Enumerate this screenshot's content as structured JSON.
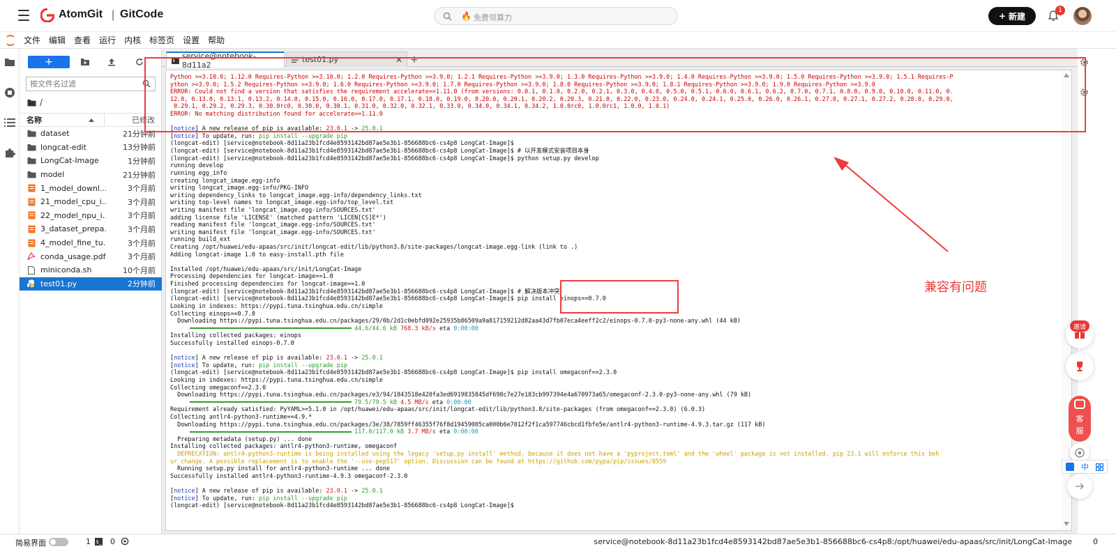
{
  "header": {
    "brand_a": "AtomGit",
    "brand_sep": "|",
    "brand_b": "GitCode",
    "search_placeholder": "免费领算力",
    "new_button": "新建",
    "notif_count": "1"
  },
  "menu": [
    "文件",
    "编辑",
    "查看",
    "运行",
    "内核",
    "标签页",
    "设置",
    "帮助"
  ],
  "filebrowser": {
    "new_label": "+",
    "filter_placeholder": "按文件名过滤",
    "breadcrumb": "/",
    "col_name": "名称",
    "col_modified": "已修改",
    "files": [
      {
        "name": "dataset",
        "time": "21分钟前",
        "kind": "folder"
      },
      {
        "name": "longcat-edit",
        "time": "13分钟前",
        "kind": "folder"
      },
      {
        "name": "LongCat-Image",
        "time": "1分钟前",
        "kind": "folder"
      },
      {
        "name": "model",
        "time": "21分钟前",
        "kind": "folder"
      },
      {
        "name": "1_model_downl...",
        "time": "3个月前",
        "kind": "notebook"
      },
      {
        "name": "21_model_cpu_i...",
        "time": "3个月前",
        "kind": "notebook"
      },
      {
        "name": "22_model_npu_i...",
        "time": "3个月前",
        "kind": "notebook"
      },
      {
        "name": "3_dataset_prepa...",
        "time": "3个月前",
        "kind": "notebook"
      },
      {
        "name": "4_model_fine_tu...",
        "time": "3个月前",
        "kind": "notebook"
      },
      {
        "name": "conda_usage.pdf",
        "time": "3个月前",
        "kind": "pdf"
      },
      {
        "name": "miniconda.sh",
        "time": "10个月前",
        "kind": "file"
      },
      {
        "name": "test01.py",
        "time": "2分钟前",
        "kind": "python"
      }
    ]
  },
  "tabs": [
    {
      "label": "service@notebook-8d11a2"
    },
    {
      "label": "test01.py"
    }
  ],
  "terminal_lines": [
    [
      {
        "t": "Python >=3.10.0; 1.12.0 Requires-Python >=3.10.0; 1.2.0 Requires-Python >=3.9.0; 1.2.1 Requires-Python >=3.9.0; 1.3.0 Requires-Python >=3.9.0; 1.4.0 Requires-Python >=3.9.0; 1.5.0 Requires-Python >=3.9.0; 1.5.1 Requires-P",
        "c": "r"
      }
    ],
    [
      {
        "t": "ython >=3.9.0; 1.5.2 Requires-Python >=3.9.0; 1.6.0 Requires-Python >=3.9.0; 1.7.0 Requires-Python >=3.9.0; 1.8.0 Requires-Python >=3.9.0; 1.8.1 Requires-Python >=3.9.0; 1.9.0 Requires-Python >=3.9.0",
        "c": "r"
      }
    ],
    [
      {
        "t": "ERROR: Could not find a version that satisfies the requirement accelerate==1.11.0 (from versions: 0.0.1, 0.1.0, 0.2.0, 0.2.1, 0.3.0, 0.4.0, 0.5.0, 0.5.1, 0.6.0, 0.6.1, 0.6.2, 0.7.0, 0.7.1, 0.8.0, 0.9.0, 0.10.0, 0.11.0, 0.",
        "c": "r"
      }
    ],
    [
      {
        "t": "12.0, 0.13.0, 0.13.1, 0.13.2, 0.14.0, 0.15.0, 0.16.0, 0.17.0, 0.17.1, 0.18.0, 0.19.0, 0.20.0, 0.20.1, 0.20.2, 0.20.3, 0.21.0, 0.22.0, 0.23.0, 0.24.0, 0.24.1, 0.25.0, 0.26.0, 0.26.1, 0.27.0, 0.27.1, 0.27.2, 0.28.0, 0.29.0,",
        "c": "r"
      }
    ],
    [
      {
        "t": " 0.29.1, 0.29.2, 0.29.3, 0.30.0rc0, 0.30.0, 0.30.1, 0.31.0, 0.32.0, 0.32.1, 0.33.0, 0.34.0, 0.34.1, 0.34.2, 1.0.0rc0, 1.0.0rc1, 1.0.0, 1.0.1)",
        "c": "r"
      }
    ],
    [
      {
        "t": "ERROR: No matching distribution found for accelerate==1.11.0",
        "c": "r"
      }
    ],
    [
      {
        "t": "",
        "c": ""
      }
    ],
    [
      {
        "t": "[",
        "c": ""
      },
      {
        "t": "notice",
        "c": "b"
      },
      {
        "t": "] A new release of pip is available: ",
        "c": ""
      },
      {
        "t": "23.0.1",
        "c": "rr"
      },
      {
        "t": " -> ",
        "c": ""
      },
      {
        "t": "25.0.1",
        "c": "g"
      }
    ],
    [
      {
        "t": "[",
        "c": ""
      },
      {
        "t": "notice",
        "c": "b"
      },
      {
        "t": "] To update, run: ",
        "c": ""
      },
      {
        "t": "pip install --upgrade pip",
        "c": "g"
      }
    ],
    [
      {
        "t": "(longcat-edit) [service@notebook-8d11a23b1fcd4e8593142bd87ae5e3b1-856688bc6-cs4p8 LongCat-Image]$",
        "c": ""
      }
    ],
    [
      {
        "t": "(longcat-edit) [service@notebook-8d11a23b1fcd4e8593142bd87ae5e3b1-856688bc6-cs4p8 LongCat-Image]$ # 以开发模式安装项目本身",
        "c": ""
      }
    ],
    [
      {
        "t": "(longcat-edit) [service@notebook-8d11a23b1fcd4e8593142bd87ae5e3b1-856688bc6-cs4p8 LongCat-Image]$ python setup.py develop",
        "c": ""
      }
    ],
    [
      {
        "t": "running develop",
        "c": ""
      }
    ],
    [
      {
        "t": "running egg_info",
        "c": ""
      }
    ],
    [
      {
        "t": "creating longcat_image.egg-info",
        "c": ""
      }
    ],
    [
      {
        "t": "writing longcat_image.egg-info/PKG-INFO",
        "c": ""
      }
    ],
    [
      {
        "t": "writing dependency_links to longcat_image.egg-info/dependency_links.txt",
        "c": ""
      }
    ],
    [
      {
        "t": "writing top-level names to longcat_image.egg-info/top_level.txt",
        "c": ""
      }
    ],
    [
      {
        "t": "writing manifest file 'longcat_image.egg-info/SOURCES.txt'",
        "c": ""
      }
    ],
    [
      {
        "t": "adding license file 'LICENSE' (matched pattern 'LICEN[CS]E*')",
        "c": ""
      }
    ],
    [
      {
        "t": "reading manifest file 'longcat_image.egg-info/SOURCES.txt'",
        "c": ""
      }
    ],
    [
      {
        "t": "writing manifest file 'longcat_image.egg-info/SOURCES.txt'",
        "c": ""
      }
    ],
    [
      {
        "t": "running build_ext",
        "c": ""
      }
    ],
    [
      {
        "t": "Creating /opt/huawei/edu-apaas/src/init/longcat-edit/lib/python3.8/site-packages/longcat-image.egg-link (link to .)",
        "c": ""
      }
    ],
    [
      {
        "t": "Adding longcat-image 1.0 to easy-install.pth file",
        "c": ""
      }
    ],
    [
      {
        "t": "",
        "c": ""
      }
    ],
    [
      {
        "t": "Installed /opt/huawei/edu-apaas/src/init/LongCat-Image",
        "c": ""
      }
    ],
    [
      {
        "t": "Processing dependencies for longcat-image==1.0",
        "c": ""
      }
    ],
    [
      {
        "t": "Finished processing dependencies for longcat-image==1.0",
        "c": ""
      }
    ],
    [
      {
        "t": "(longcat-edit) [service@notebook-8d11a23b1fcd4e8593142bd87ae5e3b1-856688bc6-cs4p8 LongCat-Image]$ # 解决版本冲突",
        "c": ""
      }
    ],
    [
      {
        "t": "(longcat-edit) [service@notebook-8d11a23b1fcd4e8593142bd87ae5e3b1-856688bc6-cs4p8 LongCat-Image]$ pip install einops==0.7.0",
        "c": ""
      }
    ],
    [
      {
        "t": "Looking in indexes: https://pypi.tuna.tsinghua.edu.cn/simple",
        "c": ""
      }
    ],
    [
      {
        "t": "Collecting einops==0.7.0",
        "c": ""
      }
    ],
    [
      {
        "t": "  Downloading https://pypi.tuna.tsinghua.edu.cn/packages/29/0b/2d1c0ebfd092e25935b86509a9a817159212d82aa43d7fb07eca4eeff2c2/einops-0.7.0-py3-none-any.whl (44 kB)",
        "c": ""
      }
    ],
    [
      {
        "t": "BAR",
        "c": "bar"
      },
      {
        "t": "44.6/44.6 kB",
        "c": "g"
      },
      {
        "t": " ",
        "c": ""
      },
      {
        "t": "768.3 kB/s",
        "c": "rr"
      },
      {
        "t": " eta ",
        "c": ""
      },
      {
        "t": "0:00:00",
        "c": "c"
      }
    ],
    [
      {
        "t": "Installing collected packages: einops",
        "c": ""
      }
    ],
    [
      {
        "t": "Successfully installed einops-0.7.0",
        "c": ""
      }
    ],
    [
      {
        "t": "",
        "c": ""
      }
    ],
    [
      {
        "t": "[",
        "c": ""
      },
      {
        "t": "notice",
        "c": "b"
      },
      {
        "t": "] A new release of pip is available: ",
        "c": ""
      },
      {
        "t": "23.0.1",
        "c": "rr"
      },
      {
        "t": " -> ",
        "c": ""
      },
      {
        "t": "25.0.1",
        "c": "g"
      }
    ],
    [
      {
        "t": "[",
        "c": ""
      },
      {
        "t": "notice",
        "c": "b"
      },
      {
        "t": "] To update, run: ",
        "c": ""
      },
      {
        "t": "pip install --upgrade pip",
        "c": "g"
      }
    ],
    [
      {
        "t": "(longcat-edit) [service@notebook-8d11a23b1fcd4e8593142bd87ae5e3b1-856688bc6-cs4p8 LongCat-Image]$ pip install omegaconf==2.3.0",
        "c": ""
      }
    ],
    [
      {
        "t": "Looking in indexes: https://pypi.tuna.tsinghua.edu.cn/simple",
        "c": ""
      }
    ],
    [
      {
        "t": "Collecting omegaconf==2.3.0",
        "c": ""
      }
    ],
    [
      {
        "t": "  Downloading https://pypi.tuna.tsinghua.edu.cn/packages/e3/94/1843518e420fa3ed6919835845df698c7e27e183cb997394e4a670973a65/omegaconf-2.3.0-py3-none-any.whl (79 kB)",
        "c": ""
      }
    ],
    [
      {
        "t": "BAR",
        "c": "bar"
      },
      {
        "t": "79.5/79.5 kB",
        "c": "g"
      },
      {
        "t": " ",
        "c": ""
      },
      {
        "t": "4.5 MB/s",
        "c": "rr"
      },
      {
        "t": " eta ",
        "c": ""
      },
      {
        "t": "0:00:00",
        "c": "c"
      }
    ],
    [
      {
        "t": "Requirement already satisfied: PyYAML>=5.1.0 in /opt/huawei/edu-apaas/src/init/longcat-edit/lib/python3.8/site-packages (from omegaconf==2.3.0) (6.0.3)",
        "c": ""
      }
    ],
    [
      {
        "t": "Collecting antlr4-python3-runtime==4.9.*",
        "c": ""
      }
    ],
    [
      {
        "t": "  Downloading https://pypi.tuna.tsinghua.edu.cn/packages/3e/38/7859ff46355f76f8d19459005ca000b6e7012f2f1ca597746cbcd1fbfe5e/antlr4-python3-runtime-4.9.3.tar.gz (117 kB)",
        "c": ""
      }
    ],
    [
      {
        "t": "BAR",
        "c": "bar"
      },
      {
        "t": "117.0/117.0 kB",
        "c": "g"
      },
      {
        "t": " ",
        "c": ""
      },
      {
        "t": "3.7 MB/s",
        "c": "rr"
      },
      {
        "t": " eta ",
        "c": ""
      },
      {
        "t": "0:00:00",
        "c": "c"
      }
    ],
    [
      {
        "t": "  Preparing metadata (setup.py) ... done",
        "c": ""
      }
    ],
    [
      {
        "t": "Installing collected packages: antlr4-python3-runtime, omegaconf",
        "c": ""
      }
    ],
    [
      {
        "t": "  DEPRECATION: antlr4-python3-runtime is being installed using the legacy 'setup.py install' method, because it does not have a 'pyproject.toml' and the 'wheel' package is not installed. pip 23.1 will enforce this beh",
        "c": "y"
      }
    ],
    [
      {
        "t": "ur change. A possible replacement is to enable the '--use-pep517' option. Discussion can be found at https://github.com/pypa/pip/issues/8559",
        "c": "y"
      }
    ],
    [
      {
        "t": "  Running setup.py install for antlr4-python3-runtime ... done",
        "c": ""
      }
    ],
    [
      {
        "t": "Successfully installed antlr4-python3-runtime-4.9.3 omegaconf-2.3.0",
        "c": ""
      }
    ],
    [
      {
        "t": "",
        "c": ""
      }
    ],
    [
      {
        "t": "[",
        "c": ""
      },
      {
        "t": "notice",
        "c": "b"
      },
      {
        "t": "] A new release of pip is available: ",
        "c": ""
      },
      {
        "t": "23.0.1",
        "c": "rr"
      },
      {
        "t": " -> ",
        "c": ""
      },
      {
        "t": "25.0.1",
        "c": "g"
      }
    ],
    [
      {
        "t": "[",
        "c": ""
      },
      {
        "t": "notice",
        "c": "b"
      },
      {
        "t": "] To update, run: ",
        "c": ""
      },
      {
        "t": "pip install --upgrade pip",
        "c": "g"
      }
    ],
    [
      {
        "t": "(longcat-edit) [service@notebook-8d11a23b1fcd4e8593142bd87ae5e3b1-856688bc6-cs4p8 LongCat-Image]$",
        "c": ""
      }
    ]
  ],
  "annotation": {
    "label": "兼容有问题"
  },
  "widgets": {
    "invite": "邀请",
    "kefu_1": "客",
    "kefu_2": "服",
    "ime_zh": "中"
  },
  "statusbar": {
    "simple_mode": "简易界面",
    "count_a": "1",
    "count_b": "0",
    "path": "service@notebook-8d11a23b1fcd4e8593142bd87ae5e3b1-856688bc6-cs4p8:/opt/huawei/edu-apaas/src/init/LongCat-Image",
    "count_c": "0"
  },
  "colors": {
    "accent": "#1976d2",
    "annotation_red": "#ef3b3b",
    "error_red": "#cc0000",
    "brand_red": "#e53935"
  }
}
